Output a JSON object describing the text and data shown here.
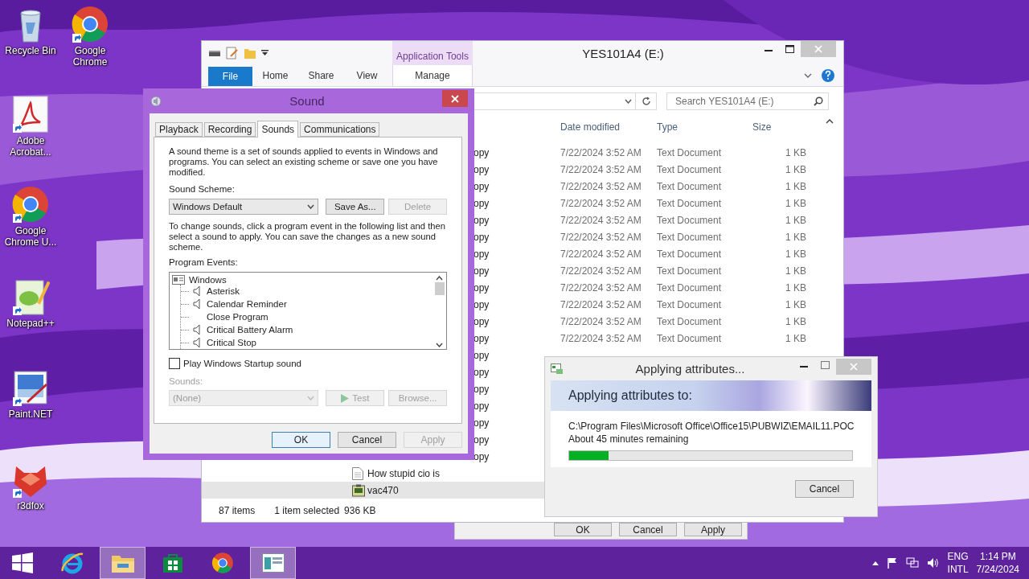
{
  "desktop_icons": [
    {
      "label": "Recycle Bin",
      "kind": "bin",
      "shortcut": false
    },
    {
      "label": "Google Chrome",
      "kind": "chrome",
      "shortcut": true
    },
    {
      "label": "Adobe Acrobat...",
      "kind": "acrobat",
      "shortcut": true
    },
    {
      "label": "Google Chrome U...",
      "kind": "chrome",
      "shortcut": true
    },
    {
      "label": "Notepad++",
      "kind": "notepad",
      "shortcut": true
    },
    {
      "label": "Paint.NET",
      "kind": "paint",
      "shortcut": true
    },
    {
      "label": "r3dfox",
      "kind": "fox",
      "shortcut": true
    }
  ],
  "background_dialog": {
    "buttons": [
      "OK",
      "Cancel",
      "Apply"
    ]
  },
  "explorer": {
    "title": "YES101A4 (E:)",
    "context_tab": "Application Tools",
    "ribbon_tabs": [
      {
        "label": "File",
        "kind": "file"
      },
      {
        "label": "Home",
        "kind": "tab"
      },
      {
        "label": "Share",
        "kind": "tab"
      },
      {
        "label": "View",
        "kind": "tab"
      },
      {
        "label": "Manage",
        "kind": "context"
      }
    ],
    "search": {
      "placeholder": "Search YES101A4 (E:)"
    },
    "columns": [
      "Date modified",
      "Type",
      "Size"
    ],
    "rows": [
      {
        "kind": "clipped",
        "name": "opy",
        "date": "7/22/2024 3:52 AM",
        "type": "Text Document",
        "size": "1 KB",
        "selected": false
      },
      {
        "kind": "clipped",
        "name": "opy",
        "date": "7/22/2024 3:52 AM",
        "type": "Text Document",
        "size": "1 KB",
        "selected": false
      },
      {
        "kind": "clipped",
        "name": "opy",
        "date": "7/22/2024 3:52 AM",
        "type": "Text Document",
        "size": "1 KB",
        "selected": false
      },
      {
        "kind": "clipped",
        "name": "opy",
        "date": "7/22/2024 3:52 AM",
        "type": "Text Document",
        "size": "1 KB",
        "selected": false
      },
      {
        "kind": "clipped",
        "name": "opy",
        "date": "7/22/2024 3:52 AM",
        "type": "Text Document",
        "size": "1 KB",
        "selected": false
      },
      {
        "kind": "clipped",
        "name": "opy",
        "date": "7/22/2024 3:52 AM",
        "type": "Text Document",
        "size": "1 KB",
        "selected": false
      },
      {
        "kind": "clipped",
        "name": "opy",
        "date": "7/22/2024 3:52 AM",
        "type": "Text Document",
        "size": "1 KB",
        "selected": false
      },
      {
        "kind": "clipped",
        "name": "opy",
        "date": "7/22/2024 3:52 AM",
        "type": "Text Document",
        "size": "1 KB",
        "selected": false
      },
      {
        "kind": "clipped",
        "name": "opy",
        "date": "7/22/2024 3:52 AM",
        "type": "Text Document",
        "size": "1 KB",
        "selected": false
      },
      {
        "kind": "clipped",
        "name": "opy",
        "date": "7/22/2024 3:52 AM",
        "type": "Text Document",
        "size": "1 KB",
        "selected": false
      },
      {
        "kind": "clipped",
        "name": "opy",
        "date": "7/22/2024 3:52 AM",
        "type": "Text Document",
        "size": "1 KB",
        "selected": false
      },
      {
        "kind": "clipped",
        "name": "opy",
        "date": "7/22/2024 3:52 AM",
        "type": "Text Document",
        "size": "1 KB",
        "selected": false
      },
      {
        "kind": "clipped",
        "name": "opy",
        "selected": false
      },
      {
        "kind": "clipped",
        "name": "opy",
        "selected": false
      },
      {
        "kind": "clipped",
        "name": "opy",
        "selected": false
      },
      {
        "kind": "clipped",
        "name": "opy",
        "selected": false
      },
      {
        "kind": "clipped",
        "name": "opy",
        "selected": false
      },
      {
        "kind": "clipped",
        "name": "opy",
        "selected": false
      },
      {
        "kind": "clipped",
        "name": "opy",
        "selected": false
      },
      {
        "kind": "document",
        "name": "How stupid cio is",
        "selected": false
      },
      {
        "kind": "program",
        "name": "vac470",
        "selected": true
      }
    ],
    "status": {
      "count": "87 items",
      "selection": "1 item selected",
      "size": "936 KB"
    }
  },
  "sound": {
    "title": "Sound",
    "tabs": [
      {
        "label": "Playback",
        "selected": false
      },
      {
        "label": "Recording",
        "selected": false
      },
      {
        "label": "Sounds",
        "selected": true
      },
      {
        "label": "Communications",
        "selected": false
      }
    ],
    "intro": "A sound theme is a set of sounds applied to events in Windows and programs.  You can select an existing scheme or save one you have modified.",
    "scheme_label": "Sound Scheme:",
    "scheme": {
      "value": "Windows Default",
      "disabled": false
    },
    "scheme_buttons": [
      {
        "label": "Save As...",
        "disabled": false
      },
      {
        "label": "Delete",
        "disabled": true
      }
    ],
    "help": "To change sounds, click a program event in the following list and then select a sound to apply.  You can save the changes as a new sound scheme.",
    "events_label": "Program Events:",
    "events": [
      {
        "label": "Windows",
        "children": [
          {
            "label": "Asterisk",
            "has_sound": true
          },
          {
            "label": "Calendar Reminder",
            "has_sound": true
          },
          {
            "label": "Close Program",
            "has_sound": false
          },
          {
            "label": "Critical Battery Alarm",
            "has_sound": true
          },
          {
            "label": "Critical Stop",
            "has_sound": true
          }
        ]
      }
    ],
    "startup": {
      "label": "Play Windows Startup sound",
      "checked": false
    },
    "sounds_label": {
      "text": "Sounds:",
      "disabled": true
    },
    "sound_select": {
      "value": "(None)",
      "disabled": true
    },
    "test": {
      "label": "Test",
      "disabled": true
    },
    "browse": {
      "label": "Browse...",
      "disabled": true
    },
    "footer": [
      {
        "label": "OK",
        "disabled": false,
        "default": true
      },
      {
        "label": "Cancel",
        "disabled": false,
        "default": false
      },
      {
        "label": "Apply",
        "disabled": true,
        "default": false
      }
    ]
  },
  "progress": {
    "title": "Applying attributes...",
    "heading": "Applying attributes to:",
    "path": "C:\\Program Files\\Microsoft Office\\Office15\\PUBWIZ\\EMAIL11.POC",
    "remaining": "About 45 minutes remaining",
    "level": 0.14,
    "cancel": "Cancel"
  },
  "taskbar": {
    "apps": [
      {
        "kind": "start",
        "selected": false
      },
      {
        "kind": "ie",
        "selected": false
      },
      {
        "kind": "explorer",
        "selected": true
      },
      {
        "kind": "store",
        "selected": false
      },
      {
        "kind": "chrome",
        "selected": false
      },
      {
        "kind": "window",
        "selected": true
      }
    ],
    "language": [
      "ENG",
      "INTL"
    ],
    "time": "1:14 PM",
    "date": "7/24/2024"
  }
}
